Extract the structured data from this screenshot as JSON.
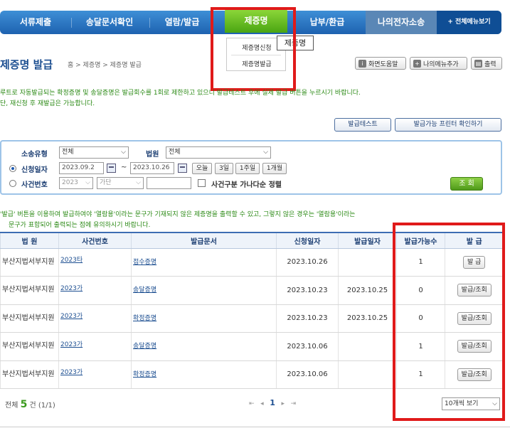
{
  "nav": {
    "items": [
      "서류제출",
      "송달문서확인",
      "열람/발급",
      "제증명",
      "납부/환급",
      "나의전자소송"
    ],
    "all_menu": "+ 전체메뉴보기",
    "dropdown": [
      "제증명신청",
      "제증명발급"
    ],
    "tooltip": "제증명"
  },
  "header": {
    "title": "제증명 발급",
    "breadcrumb": "홈 > 제증명 > 제증명 발급",
    "help_label": "화면도움말",
    "mymenu_label": "나의메뉴추가",
    "print_label": "출력"
  },
  "notice": {
    "line1": "루트로 자동발급되는 확정증명 및 송달증명은 발급회수를 1회로 제한하고 있으니 발급테스트 후에 실제 발급 버튼을 누르시기 바랍니다.",
    "line2": "단, 재신청 후 재발급은 가능합니다."
  },
  "test_buttons": {
    "test": "발급테스트",
    "printer": "발급가능 프린터 확인하기"
  },
  "search": {
    "case_type_label": "소송유형",
    "case_type_value": "전체",
    "court_label": "법원",
    "court_value": "전체",
    "date_label": "신청일자",
    "date_from": "2023.09.2",
    "tilde": "~",
    "date_to": "2023.10.26",
    "quick": [
      "오늘",
      "3일",
      "1주일",
      "1개월"
    ],
    "case_no_label": "사건번호",
    "year_value": "2023",
    "kind_value": "가단",
    "sort_label": "사건구분 가나다순 정렬",
    "search_button": "조 회"
  },
  "notice2": {
    "line1": "'발급' 버튼을 이용하여 발급하여야 '열람용'이라는 문구가 기재되지 않은 제증명을 출력할 수 있고, 그렇지 않은 경우는 '열람용'이라는",
    "line2": "문구가 표함되어 출력되는 점에 유의하시기 바랍니다."
  },
  "table": {
    "headers": [
      "법 원",
      "사건번호",
      "발급문서",
      "신청일자",
      "발급일자",
      "발급가능수",
      "발 급"
    ],
    "rows": [
      {
        "court": "부산지법서부지원",
        "case": "2023타",
        "doc": "접수증명",
        "req": "2023.10.26",
        "issued": "",
        "count": "1",
        "action": "발 급"
      },
      {
        "court": "부산지법서부지원",
        "case": "2023가",
        "doc": "송달증명",
        "req": "2023.10.23",
        "issued": "2023.10.25",
        "count": "0",
        "action": "발급/조회"
      },
      {
        "court": "부산지법서부지원",
        "case": "2023가",
        "doc": "확정증명",
        "req": "2023.10.23",
        "issued": "2023.10.25",
        "count": "0",
        "action": "발급/조회"
      },
      {
        "court": "부산지법서부지원",
        "case": "2023가",
        "doc": "송달증명",
        "req": "2023.10.06",
        "issued": "",
        "count": "1",
        "action": "발급/조회"
      },
      {
        "court": "부산지법서부지원",
        "case": "2023가",
        "doc": "확정증명",
        "req": "2023.10.06",
        "issued": "",
        "count": "1",
        "action": "발급/조회"
      }
    ]
  },
  "footer": {
    "total_prefix": "전체",
    "total_count": "5",
    "total_suffix": "건 (1/1)",
    "current_page": "1",
    "page_size": "10개씩 보기"
  },
  "colors": {
    "nav": "#2b76c6",
    "active": "#6cc02a",
    "highlight": "#e01a1a"
  }
}
